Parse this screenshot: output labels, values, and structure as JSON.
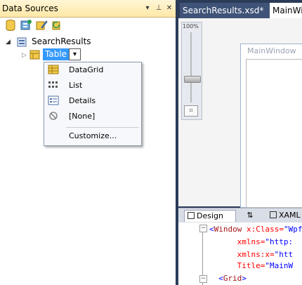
{
  "panel": {
    "title": "Data Sources",
    "dropdown_glyph": "▾",
    "pin_glyph": "⊥",
    "close_glyph": "✕",
    "toolbar_icons": [
      "database-icon",
      "add-datasource-icon",
      "edit-dataset-icon",
      "refresh-icon"
    ]
  },
  "tree": {
    "root_label": "SearchResults",
    "child_label": "Table",
    "dropdown_glyph": "▾"
  },
  "context_menu": {
    "items": [
      {
        "label": "DataGrid",
        "icon": "datagrid-icon"
      },
      {
        "label": "List",
        "icon": "list-icon"
      },
      {
        "label": "Details",
        "icon": "details-icon"
      },
      {
        "label": "[None]",
        "icon": "none-icon"
      },
      {
        "label": "Customize...",
        "icon": ""
      }
    ]
  },
  "document_tabs": [
    {
      "label": "SearchResults.xsd*",
      "active": false
    },
    {
      "label": "MainWi",
      "active": true
    }
  ],
  "designer": {
    "zoom_label": "100%",
    "window_title": "MainWindow"
  },
  "split_tabs": {
    "design": "Design",
    "swap": "⇅",
    "xaml": "XAML"
  },
  "xaml_lines": [
    {
      "indent": 0,
      "parts": [
        [
          "brk",
          "<"
        ],
        [
          "tag",
          "Window"
        ],
        [
          "attr",
          " x:Class="
        ],
        [
          "val",
          "\"Wpf"
        ]
      ]
    },
    {
      "indent": 6,
      "parts": [
        [
          "attr",
          "xmlns="
        ],
        [
          "val",
          "\"http:"
        ]
      ]
    },
    {
      "indent": 6,
      "parts": [
        [
          "attr",
          "xmlns:x="
        ],
        [
          "val",
          "\"htt"
        ]
      ]
    },
    {
      "indent": 6,
      "parts": [
        [
          "attr",
          "Title="
        ],
        [
          "val",
          "\"MainW"
        ]
      ]
    },
    {
      "indent": 2,
      "parts": [
        [
          "brk",
          "<"
        ],
        [
          "tag",
          "Grid"
        ],
        [
          "brk",
          ">"
        ]
      ]
    }
  ],
  "colors": {
    "accent": "#3399ff",
    "panel_title_bg": "#ffe8a6",
    "ide_dark": "#2b3c59"
  }
}
